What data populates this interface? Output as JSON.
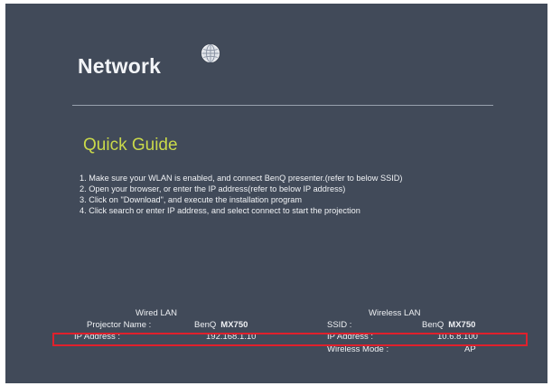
{
  "header": {
    "title": "Network",
    "globe_icon": "globe-icon"
  },
  "quick_guide": {
    "heading": "Quick Guide",
    "steps": [
      "1. Make sure your WLAN is enabled, and connect BenQ presenter.(refer to below SSID)",
      "2. Open your browser, or enter the IP address(refer to below IP address)",
      "3. Click on \"Download\", and execute the installation program",
      "4. Click search or enter IP address, and select connect to start the projection"
    ]
  },
  "wired_lan": {
    "heading": "Wired LAN",
    "projector_name_label": "Projector Name :",
    "projector_name_brand": "BenQ",
    "projector_name_model": "MX750",
    "ip_label": "IP Address :",
    "ip_value": "192.168.1.10"
  },
  "wireless_lan": {
    "heading": "Wireless LAN",
    "ssid_label": "SSID :",
    "ssid_brand": "BenQ",
    "ssid_model": "MX750",
    "ip_label": "IP Address :",
    "ip_value": "10.6.8.100",
    "mode_label": "Wireless Mode :",
    "mode_value": "AP"
  },
  "colors": {
    "background": "#414a59",
    "quick_guide_heading": "#c9d94a",
    "highlight_box": "#e0202c"
  }
}
